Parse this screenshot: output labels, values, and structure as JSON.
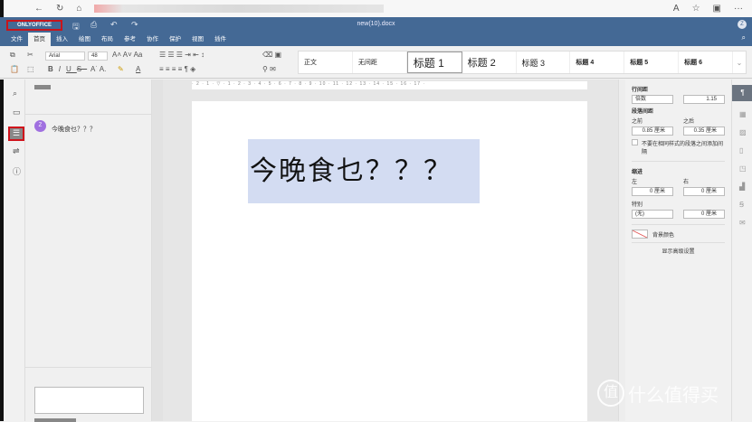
{
  "browser": {
    "icons": [
      "back-icon",
      "reload-icon",
      "home-icon"
    ],
    "ext_icons": [
      "read-aloud-icon",
      "favorite-icon",
      "extensions-icon",
      "more-icon"
    ]
  },
  "header": {
    "logo": "ONLYOFFICE",
    "title": "new(10).docx",
    "user_initial": "Z"
  },
  "tabs": [
    "文件",
    "首页",
    "插入",
    "绘图",
    "布局",
    "参考",
    "协作",
    "保护",
    "视图",
    "插件"
  ],
  "active_tab": "首页",
  "toolbar": {
    "font": "Arial",
    "size": "48",
    "styles": [
      "正文",
      "无间距",
      "标题 1",
      "标题 2",
      "标题 3",
      "标题 4",
      "标题 5",
      "标题 6"
    ]
  },
  "comments": {
    "author": "Z",
    "text": "今晚食乜？？？"
  },
  "document": {
    "text": "今晚食乜？？？",
    "highlight": "#d3dcf2"
  },
  "ruler": "· 2 · 1 · ▽ · 1 · 2 · 3 · 4 · 5 · 6 · 7 · 8 · 9 · 10 · 11 · 12 · 13 · 14 · 15 · 16 · 17 ·",
  "right_panel": {
    "line_spacing_label": "行间距",
    "line_spacing_mode": "倍数",
    "line_spacing_value": "1.15",
    "para_spacing_label": "段落间距",
    "before_label": "之前",
    "before_value": "0.85 厘米",
    "after_label": "之后",
    "after_value": "0.35 厘米",
    "no_space_label": "不要在相同样式的段落之间添加间隔",
    "indent_label": "缩进",
    "left_label": "左",
    "left_value": "0 厘米",
    "right_label": "右",
    "right_value": "0 厘米",
    "special_label": "特别",
    "special_mode": "(无)",
    "special_value": "0 厘米",
    "bg_color_label": "背景颜色",
    "advanced_label": "显示高级设置"
  },
  "watermark": "什么值得买",
  "accent": "#446995"
}
